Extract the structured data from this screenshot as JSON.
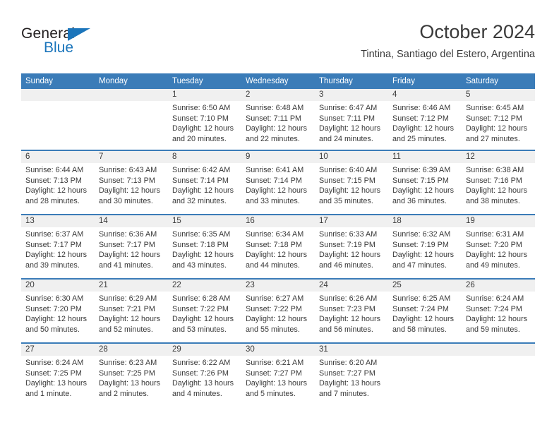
{
  "brand": {
    "name_dark": "General",
    "name_blue": "Blue",
    "accent_color": "#1b75bb"
  },
  "header": {
    "title": "October 2024",
    "subtitle": "Tintina, Santiago del Estero, Argentina"
  },
  "colors": {
    "header_blue": "#3b7cb8",
    "day_band_gray": "#f0f0f0",
    "text": "#3a3a3a"
  },
  "weekdays": [
    "Sunday",
    "Monday",
    "Tuesday",
    "Wednesday",
    "Thursday",
    "Friday",
    "Saturday"
  ],
  "weeks": [
    [
      {
        "day": "",
        "lines": []
      },
      {
        "day": "",
        "lines": []
      },
      {
        "day": "1",
        "lines": [
          "Sunrise: 6:50 AM",
          "Sunset: 7:10 PM",
          "Daylight: 12 hours",
          "and 20 minutes."
        ]
      },
      {
        "day": "2",
        "lines": [
          "Sunrise: 6:48 AM",
          "Sunset: 7:11 PM",
          "Daylight: 12 hours",
          "and 22 minutes."
        ]
      },
      {
        "day": "3",
        "lines": [
          "Sunrise: 6:47 AM",
          "Sunset: 7:11 PM",
          "Daylight: 12 hours",
          "and 24 minutes."
        ]
      },
      {
        "day": "4",
        "lines": [
          "Sunrise: 6:46 AM",
          "Sunset: 7:12 PM",
          "Daylight: 12 hours",
          "and 25 minutes."
        ]
      },
      {
        "day": "5",
        "lines": [
          "Sunrise: 6:45 AM",
          "Sunset: 7:12 PM",
          "Daylight: 12 hours",
          "and 27 minutes."
        ]
      }
    ],
    [
      {
        "day": "6",
        "lines": [
          "Sunrise: 6:44 AM",
          "Sunset: 7:13 PM",
          "Daylight: 12 hours",
          "and 28 minutes."
        ]
      },
      {
        "day": "7",
        "lines": [
          "Sunrise: 6:43 AM",
          "Sunset: 7:13 PM",
          "Daylight: 12 hours",
          "and 30 minutes."
        ]
      },
      {
        "day": "8",
        "lines": [
          "Sunrise: 6:42 AM",
          "Sunset: 7:14 PM",
          "Daylight: 12 hours",
          "and 32 minutes."
        ]
      },
      {
        "day": "9",
        "lines": [
          "Sunrise: 6:41 AM",
          "Sunset: 7:14 PM",
          "Daylight: 12 hours",
          "and 33 minutes."
        ]
      },
      {
        "day": "10",
        "lines": [
          "Sunrise: 6:40 AM",
          "Sunset: 7:15 PM",
          "Daylight: 12 hours",
          "and 35 minutes."
        ]
      },
      {
        "day": "11",
        "lines": [
          "Sunrise: 6:39 AM",
          "Sunset: 7:15 PM",
          "Daylight: 12 hours",
          "and 36 minutes."
        ]
      },
      {
        "day": "12",
        "lines": [
          "Sunrise: 6:38 AM",
          "Sunset: 7:16 PM",
          "Daylight: 12 hours",
          "and 38 minutes."
        ]
      }
    ],
    [
      {
        "day": "13",
        "lines": [
          "Sunrise: 6:37 AM",
          "Sunset: 7:17 PM",
          "Daylight: 12 hours",
          "and 39 minutes."
        ]
      },
      {
        "day": "14",
        "lines": [
          "Sunrise: 6:36 AM",
          "Sunset: 7:17 PM",
          "Daylight: 12 hours",
          "and 41 minutes."
        ]
      },
      {
        "day": "15",
        "lines": [
          "Sunrise: 6:35 AM",
          "Sunset: 7:18 PM",
          "Daylight: 12 hours",
          "and 43 minutes."
        ]
      },
      {
        "day": "16",
        "lines": [
          "Sunrise: 6:34 AM",
          "Sunset: 7:18 PM",
          "Daylight: 12 hours",
          "and 44 minutes."
        ]
      },
      {
        "day": "17",
        "lines": [
          "Sunrise: 6:33 AM",
          "Sunset: 7:19 PM",
          "Daylight: 12 hours",
          "and 46 minutes."
        ]
      },
      {
        "day": "18",
        "lines": [
          "Sunrise: 6:32 AM",
          "Sunset: 7:19 PM",
          "Daylight: 12 hours",
          "and 47 minutes."
        ]
      },
      {
        "day": "19",
        "lines": [
          "Sunrise: 6:31 AM",
          "Sunset: 7:20 PM",
          "Daylight: 12 hours",
          "and 49 minutes."
        ]
      }
    ],
    [
      {
        "day": "20",
        "lines": [
          "Sunrise: 6:30 AM",
          "Sunset: 7:20 PM",
          "Daylight: 12 hours",
          "and 50 minutes."
        ]
      },
      {
        "day": "21",
        "lines": [
          "Sunrise: 6:29 AM",
          "Sunset: 7:21 PM",
          "Daylight: 12 hours",
          "and 52 minutes."
        ]
      },
      {
        "day": "22",
        "lines": [
          "Sunrise: 6:28 AM",
          "Sunset: 7:22 PM",
          "Daylight: 12 hours",
          "and 53 minutes."
        ]
      },
      {
        "day": "23",
        "lines": [
          "Sunrise: 6:27 AM",
          "Sunset: 7:22 PM",
          "Daylight: 12 hours",
          "and 55 minutes."
        ]
      },
      {
        "day": "24",
        "lines": [
          "Sunrise: 6:26 AM",
          "Sunset: 7:23 PM",
          "Daylight: 12 hours",
          "and 56 minutes."
        ]
      },
      {
        "day": "25",
        "lines": [
          "Sunrise: 6:25 AM",
          "Sunset: 7:24 PM",
          "Daylight: 12 hours",
          "and 58 minutes."
        ]
      },
      {
        "day": "26",
        "lines": [
          "Sunrise: 6:24 AM",
          "Sunset: 7:24 PM",
          "Daylight: 12 hours",
          "and 59 minutes."
        ]
      }
    ],
    [
      {
        "day": "27",
        "lines": [
          "Sunrise: 6:24 AM",
          "Sunset: 7:25 PM",
          "Daylight: 13 hours",
          "and 1 minute."
        ]
      },
      {
        "day": "28",
        "lines": [
          "Sunrise: 6:23 AM",
          "Sunset: 7:25 PM",
          "Daylight: 13 hours",
          "and 2 minutes."
        ]
      },
      {
        "day": "29",
        "lines": [
          "Sunrise: 6:22 AM",
          "Sunset: 7:26 PM",
          "Daylight: 13 hours",
          "and 4 minutes."
        ]
      },
      {
        "day": "30",
        "lines": [
          "Sunrise: 6:21 AM",
          "Sunset: 7:27 PM",
          "Daylight: 13 hours",
          "and 5 minutes."
        ]
      },
      {
        "day": "31",
        "lines": [
          "Sunrise: 6:20 AM",
          "Sunset: 7:27 PM",
          "Daylight: 13 hours",
          "and 7 minutes."
        ]
      },
      {
        "day": "",
        "lines": []
      },
      {
        "day": "",
        "lines": []
      }
    ]
  ]
}
